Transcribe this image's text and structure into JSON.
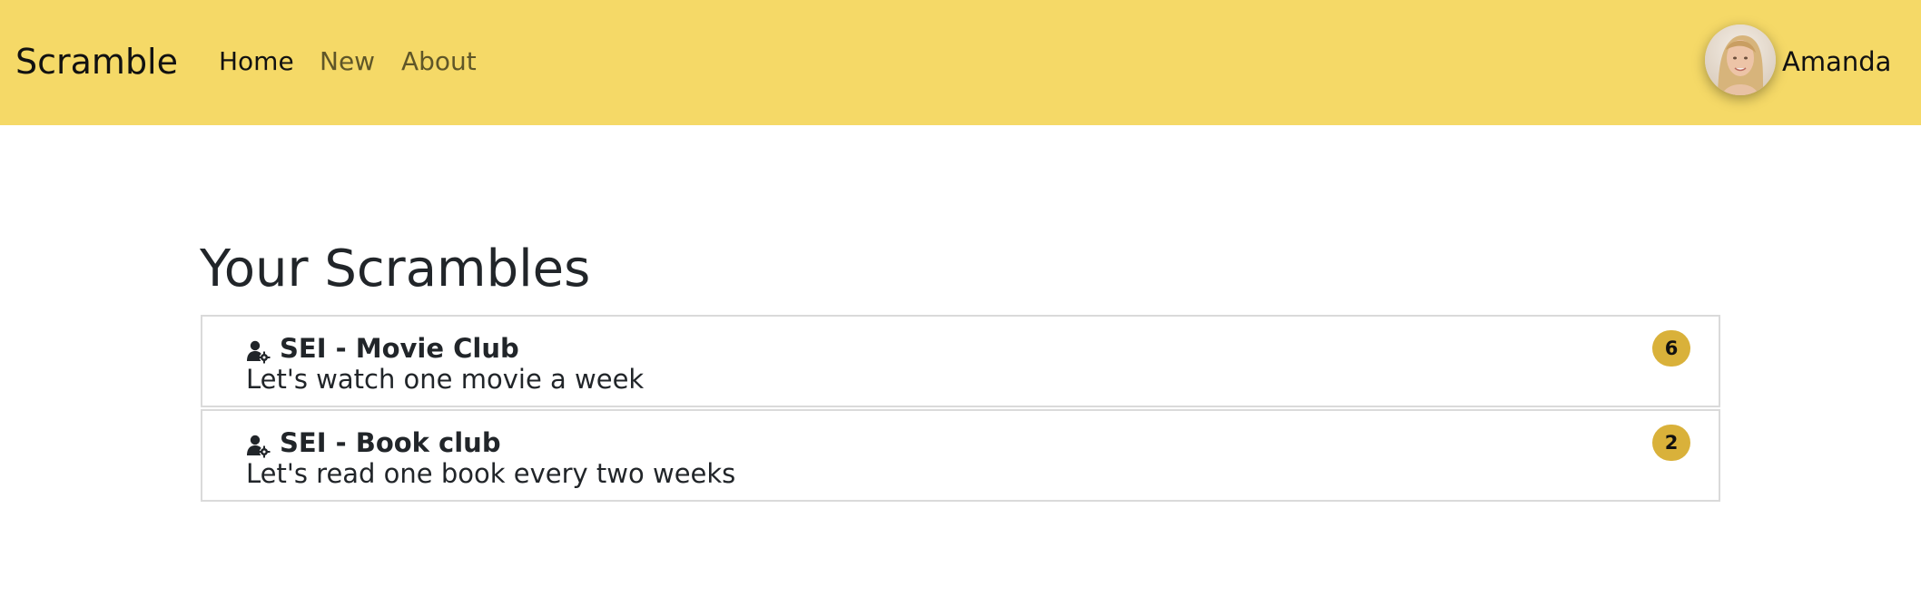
{
  "navbar": {
    "brand": "Scramble",
    "links": [
      "Home",
      "New",
      "About"
    ],
    "active_link": "Home",
    "background_color": "#f5d967"
  },
  "user": {
    "name": "Amanda",
    "avatar_icon": "user-avatar-photo"
  },
  "main": {
    "title": "Your Scrambles",
    "scrambles": [
      {
        "icon": "user-gear-icon",
        "title": "SEI - Movie Club",
        "description": "Let's watch one movie a week",
        "count": "6"
      },
      {
        "icon": "user-gear-icon",
        "title": "SEI - Book club",
        "description": "Let's read one book every two weeks",
        "count": "2"
      }
    ]
  },
  "colors": {
    "badge": "#d9b13a",
    "text": "#212529"
  }
}
